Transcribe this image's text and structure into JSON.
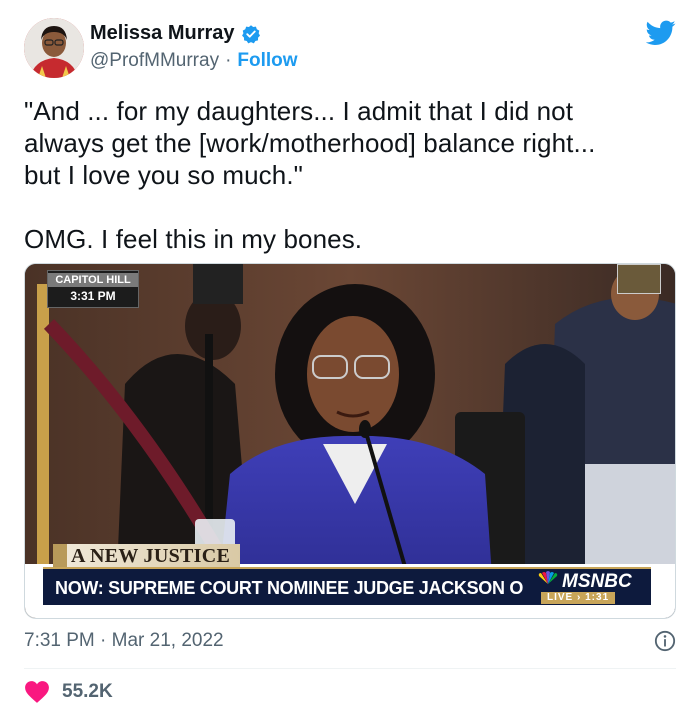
{
  "author": {
    "display_name": "Melissa Murray",
    "handle": "@ProfMMurray",
    "separator": "·",
    "follow_label": "Follow",
    "verified": true
  },
  "tweet": {
    "text": "\"And ... for my daughters... I admit that I did not\nalways get the [work/motherhood] balance right...\nbut I love you so much.\"\n\nOMG.  I feel this in my bones."
  },
  "media": {
    "bug_line1": "CAPITOL HILL",
    "bug_line2": "3:31 PM",
    "lower_third_title": "A NEW JUSTICE",
    "lower_third_text": "NOW: SUPREME COURT NOMINEE JUDGE JACKSON OPENING REMARKS",
    "network": "MSNBC",
    "live_label": "LIVE  ›  1:31"
  },
  "meta": {
    "time": "7:31 PM",
    "separator": "·",
    "date": "Mar 21, 2022",
    "likes": "55.2K"
  },
  "colors": {
    "accent": "#1d9bf0",
    "heart": "#f91880",
    "muted": "#536471"
  },
  "icons": {
    "verified": "verified-badge-icon",
    "logo": "twitter-bird-icon",
    "info": "info-icon",
    "like": "heart-icon"
  }
}
